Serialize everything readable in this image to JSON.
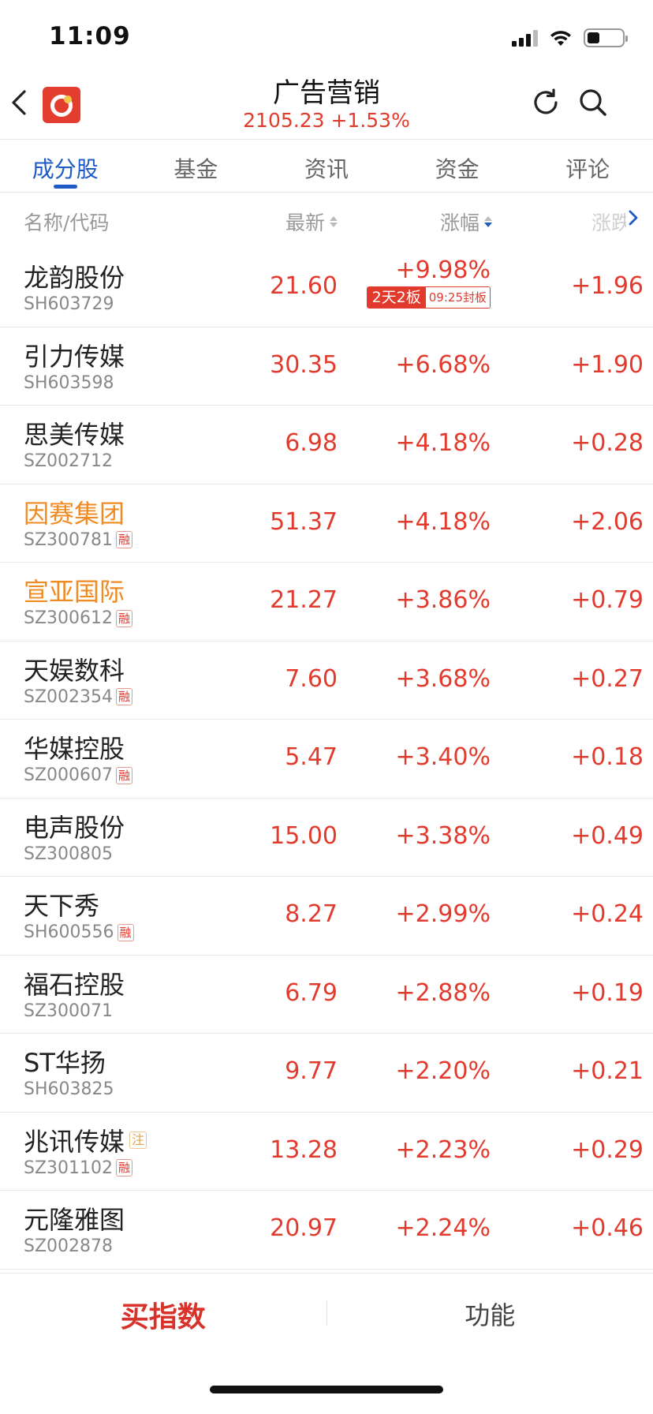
{
  "status_bar": {
    "time": "11:09",
    "battery_level": 0.35
  },
  "header": {
    "title": "广告营销",
    "subtitle": "2105.23  +1.53%"
  },
  "tabs": [
    {
      "label": "成分股",
      "active": true
    },
    {
      "label": "基金",
      "active": false
    },
    {
      "label": "资讯",
      "active": false
    },
    {
      "label": "资金",
      "active": false
    },
    {
      "label": "评论",
      "active": false
    }
  ],
  "columns": {
    "name": "名称/代码",
    "price": "最新",
    "pct": "涨幅",
    "chg": "涨跌"
  },
  "rows": [
    {
      "name": "龙韵股份",
      "code": "SH603729",
      "price": "21.60",
      "pct": "+9.98%",
      "chg": "+1.96",
      "badge1": "2天2板",
      "badge2": "09:25封板"
    },
    {
      "name": "引力传媒",
      "code": "SH603598",
      "price": "30.35",
      "pct": "+6.68%",
      "chg": "+1.90"
    },
    {
      "name": "思美传媒",
      "code": "SZ002712",
      "price": "6.98",
      "pct": "+4.18%",
      "chg": "+0.28"
    },
    {
      "name": "因赛集团",
      "code": "SZ300781",
      "price": "51.37",
      "pct": "+4.18%",
      "chg": "+2.06",
      "tag": "融"
    },
    {
      "name": "宣亚国际",
      "code": "SZ300612",
      "price": "21.27",
      "pct": "+3.86%",
      "chg": "+0.79",
      "tag": "融"
    },
    {
      "name": "天娱数科",
      "code": "SZ002354",
      "price": "7.60",
      "pct": "+3.68%",
      "chg": "+0.27",
      "tag": "融"
    },
    {
      "name": "华媒控股",
      "code": "SZ000607",
      "price": "5.47",
      "pct": "+3.40%",
      "chg": "+0.18",
      "tag": "融"
    },
    {
      "name": "电声股份",
      "code": "SZ300805",
      "price": "15.00",
      "pct": "+3.38%",
      "chg": "+0.49"
    },
    {
      "name": "天下秀",
      "code": "SH600556",
      "price": "8.27",
      "pct": "+2.99%",
      "chg": "+0.24",
      "tag": "融"
    },
    {
      "name": "福石控股",
      "code": "SZ300071",
      "price": "6.79",
      "pct": "+2.88%",
      "chg": "+0.19"
    },
    {
      "name": "ST华扬",
      "code": "SH603825",
      "price": "9.77",
      "pct": "+2.20%",
      "chg": "+0.21"
    },
    {
      "name": "兆讯传媒",
      "code": "SZ301102",
      "price": "13.28",
      "pct": "+2.23%",
      "chg": "+0.29",
      "tag": "融",
      "name_tag": "注"
    },
    {
      "name": "元隆雅图",
      "code": "SZ002878",
      "price": "20.97",
      "pct": "+2.24%",
      "chg": "+0.46"
    }
  ],
  "bottom_bar": {
    "buy_index": "买指数",
    "function": "功能"
  },
  "colors": {
    "up_red": "#e23b2e",
    "accent_blue": "#1f5bc4",
    "highlight_orange": "#f08b23"
  }
}
